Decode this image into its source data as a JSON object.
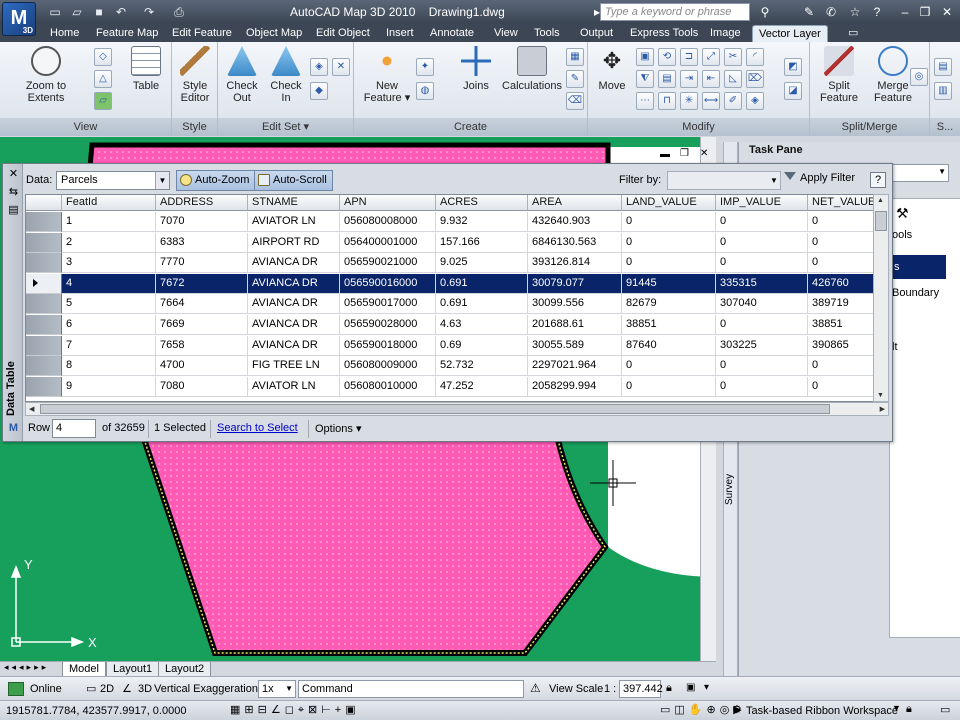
{
  "window": {
    "title": "AutoCAD Map 3D 2010    Drawing1.dwg",
    "app_logo": "M",
    "app_logo_sub": "3D",
    "search_placeholder": "Type a keyword or phrase"
  },
  "tabs": [
    "Home",
    "Feature Map",
    "Edit Feature",
    "Object Map",
    "Edit Object",
    "Insert",
    "Annotate",
    "View",
    "Tools",
    "Output",
    "Express Tools",
    "Image",
    "Vector Layer"
  ],
  "active_tab": "Vector Layer",
  "ribbon": {
    "view": {
      "title": "View",
      "zoom_label": "Zoom to Extents",
      "table_label": "Table"
    },
    "style": {
      "title": "Style",
      "editor_label": "Style Editor"
    },
    "editset": {
      "title": "Edit Set",
      "checkout_label": "Check Out",
      "checkin_label": "Check In"
    },
    "create": {
      "title": "Create",
      "newfeature_label": "New Feature",
      "joins_label": "Joins",
      "calc_label": "Calculations"
    },
    "modify": {
      "title": "Modify",
      "move_label": "Move"
    },
    "splitmerge": {
      "title": "Split/Merge",
      "split_label": "Split Feature",
      "merge_label": "Merge Feature"
    },
    "more": {
      "title": "S..."
    }
  },
  "datatable": {
    "side_label": "Data Table",
    "data_label": "Data:",
    "data_value": "Parcels",
    "autozoom_label": "Auto-Zoom",
    "autoscroll_label": "Auto-Scroll",
    "filter_label": "Filter by:",
    "apply_filter_label": "Apply Filter",
    "help_label": "?",
    "columns": [
      "FeatId",
      "ADDRESS",
      "STNAME",
      "APN",
      "ACRES",
      "AREA",
      "LAND_VALUE",
      "IMP_VALUE",
      "NET_VALUE"
    ],
    "rows": [
      [
        "1",
        "7070",
        "AVIATOR LN",
        "056080008000",
        "9.932",
        "432640.903",
        "0",
        "0",
        "0"
      ],
      [
        "2",
        "6383",
        "AIRPORT RD",
        "056400001000",
        "157.166",
        "6846130.563",
        "0",
        "0",
        "0"
      ],
      [
        "3",
        "7770",
        "AVIANCA DR",
        "056590021000",
        "9.025",
        "393126.814",
        "0",
        "0",
        "0"
      ],
      [
        "4",
        "7672",
        "AVIANCA DR",
        "056590016000",
        "0.691",
        "30079.077",
        "91445",
        "335315",
        "426760"
      ],
      [
        "5",
        "7664",
        "AVIANCA DR",
        "056590017000",
        "0.691",
        "30099.556",
        "82679",
        "307040",
        "389719"
      ],
      [
        "6",
        "7669",
        "AVIANCA DR",
        "056590028000",
        "4.63",
        "201688.61",
        "38851",
        "0",
        "38851"
      ],
      [
        "7",
        "7658",
        "AVIANCA DR",
        "056590018000",
        "0.69",
        "30055.589",
        "87640",
        "303225",
        "390865"
      ],
      [
        "8",
        "4700",
        "FIG TREE LN",
        "056080009000",
        "52.732",
        "2297021.964",
        "0",
        "0",
        "0"
      ],
      [
        "9",
        "7080",
        "AVIATOR LN",
        "056080010000",
        "47.252",
        "2058299.994",
        "0",
        "0",
        "0"
      ]
    ],
    "selected_row_index": 3,
    "footer": {
      "row_label": "Row",
      "row_value": "4",
      "of_label": "of 32659",
      "selected_label": "1 Selected",
      "search_link": "Search to Select",
      "options_label": "Options"
    }
  },
  "taskpane": {
    "title": "Task Pane",
    "fragments": [
      "ools",
      "s",
      "Boundary",
      "lt"
    ],
    "survey_label": "Survey"
  },
  "layout_tabs": [
    "Model",
    "Layout1",
    "Layout2"
  ],
  "statusbar": {
    "online": "Online",
    "mode2d": "2D",
    "mode3d": "3D",
    "vert_exag": "Vertical Exaggeration:",
    "vert_exag_value": "1x",
    "command": "Command",
    "view_scale": "View Scale",
    "view_scale_prefix": "1 :",
    "view_scale_value": "397.442",
    "coords": "1915781.7784, 423577.9917, 0.0000",
    "workspace": "Task-based Ribbon Workspace"
  },
  "axis": {
    "x": "X",
    "y": "Y"
  },
  "colors": {
    "parcel_fill": "#ff5ab4",
    "ground": "#17a05b",
    "selection": "#0a246a",
    "highlight": "#f2ea58"
  }
}
